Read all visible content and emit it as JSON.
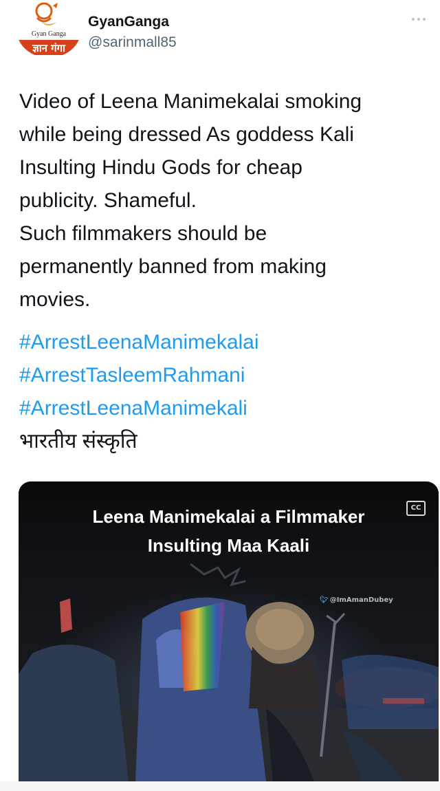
{
  "user": {
    "display_name": "GyanGanga",
    "handle": "@sarinmall85",
    "avatar_text_top": "Gyan Ganga",
    "avatar_text_bottom": "ज्ञान गंगा"
  },
  "tweet": {
    "lines": [
      "Video of Leena Manimekalai smoking",
      "while being dressed As goddess Kali",
      "Insulting Hindu Gods for cheap",
      "publicity. Shameful.",
      "Such filmmakers should be",
      "permanently banned from making",
      "movies."
    ],
    "hashtags": [
      "#ArrestLeenaManimekalai",
      "#ArrestTasleemRahmani",
      "#ArrestLeenaManimekali"
    ],
    "hindi_line": "भारतीय संस्कृति"
  },
  "media": {
    "caption_line1": "Leena Manimekalai a Filmmaker",
    "caption_line2": "Insulting Maa Kaali",
    "watermark": "@ImAmanDubey",
    "cc_label": "CC"
  },
  "colors": {
    "hashtag": "#1d9bf0",
    "handle": "#536471",
    "text": "#0f1419",
    "avatar_brand": "#e05a0c"
  },
  "icons": [
    "more-icon",
    "cc-icon",
    "twitter-bird-icon"
  ]
}
